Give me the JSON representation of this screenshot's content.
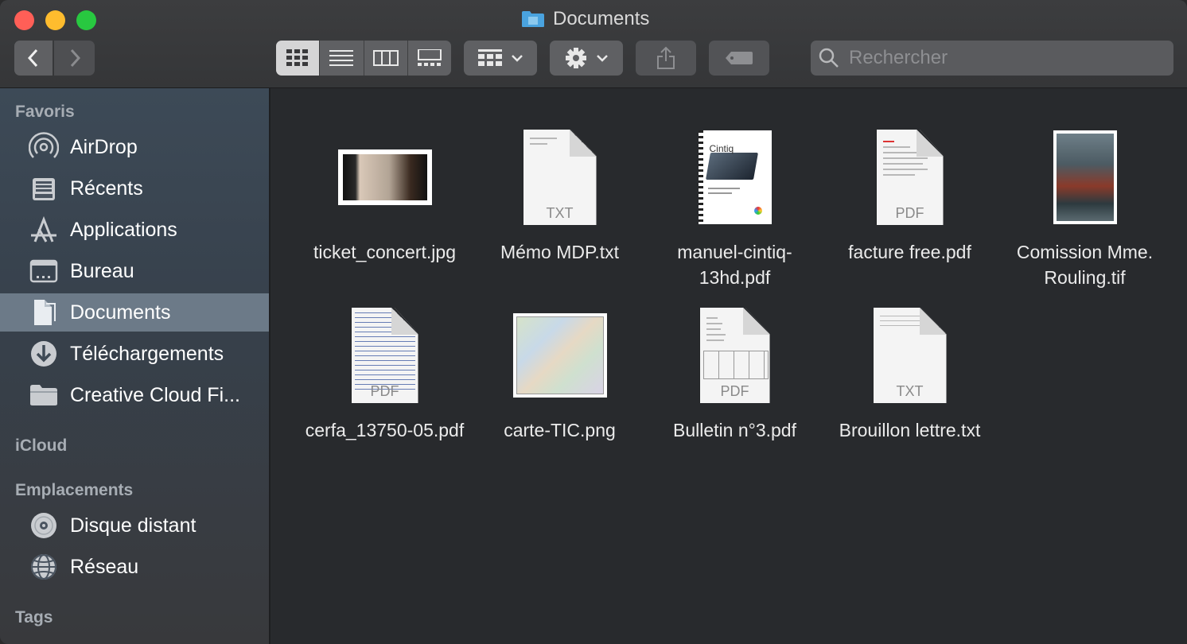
{
  "window": {
    "title": "Documents",
    "folder_icon": "folder-blue-icon"
  },
  "toolbar": {
    "search_placeholder": "Rechercher",
    "view_modes": [
      "icons",
      "list",
      "columns",
      "gallery"
    ],
    "active_view": "icons"
  },
  "sidebar": {
    "favoris_title": "Favoris",
    "favoris": [
      {
        "label": "AirDrop",
        "icon": "airdrop-icon"
      },
      {
        "label": "Récents",
        "icon": "recents-icon"
      },
      {
        "label": "Applications",
        "icon": "applications-icon"
      },
      {
        "label": "Bureau",
        "icon": "desktop-icon"
      },
      {
        "label": "Documents",
        "icon": "documents-icon",
        "selected": true
      },
      {
        "label": "Téléchargements",
        "icon": "downloads-icon"
      },
      {
        "label": "Creative Cloud Fi...",
        "icon": "folder-icon"
      }
    ],
    "icloud_title": "iCloud",
    "emplacements_title": "Emplacements",
    "emplacements": [
      {
        "label": "Disque distant",
        "icon": "disc-icon"
      },
      {
        "label": "Réseau",
        "icon": "network-icon"
      }
    ],
    "tags_title": "Tags"
  },
  "files": [
    {
      "name": "ticket_concert.jpg",
      "kind": "image"
    },
    {
      "name": "Mémo MDP.txt",
      "kind": "txt",
      "badge": "TXT"
    },
    {
      "name": "manuel-cintiq-13hd.pdf",
      "kind": "pdf-preview"
    },
    {
      "name": "facture free.pdf",
      "kind": "pdf",
      "badge": "PDF"
    },
    {
      "name": "Comission Mme. Rouling.tif",
      "kind": "image"
    },
    {
      "name": "cerfa_13750-05.pdf",
      "kind": "pdf",
      "badge": "PDF"
    },
    {
      "name": "carte-TIC.png",
      "kind": "image"
    },
    {
      "name": "Bulletin n°3.pdf",
      "kind": "pdf",
      "badge": "PDF"
    },
    {
      "name": "Brouillon lettre.txt",
      "kind": "txt",
      "badge": "TXT"
    }
  ],
  "colors": {
    "selection": "#6c7a88",
    "background": "#282a2d",
    "accent": "#4aa3df"
  }
}
